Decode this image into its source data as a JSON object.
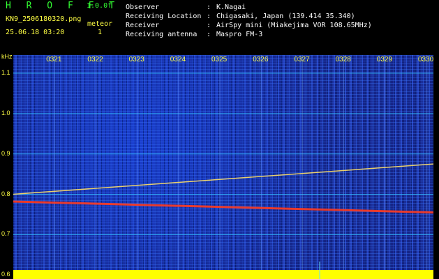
{
  "header": {
    "app_title": "H R O F F T",
    "version": "1.0.0f",
    "filename": "KN9_2506180320.png",
    "timestamp": "25.06.18 03:20",
    "meteor_label": "meteor",
    "meteor_count": "1",
    "info": [
      {
        "key": "Observer",
        "sep": ":",
        "value": "K.Nagai"
      },
      {
        "key": "Receiving Location",
        "sep": ":",
        "value": "Chigasaki, Japan (139.414 35.340)"
      },
      {
        "key": "Receiver",
        "sep": ":",
        "value": "AirSpy mini (Miakejima VOR 108.65MHz)"
      },
      {
        "key": "Receiving antenna",
        "sep": ":",
        "value": "Maspro FM-3"
      }
    ]
  },
  "colors": {
    "label": "#ffff44",
    "title": "#33ff33",
    "grid": "#33c8ff",
    "trace_lower": "#ff3b1f",
    "trace_upper": "#ffe066",
    "baseline": "#ffff00"
  },
  "chart_data": {
    "type": "heatmap",
    "ylabel": "kHz",
    "yticks": [
      "1.1",
      "1.0",
      "0.9",
      "0.8",
      "0.7",
      "0.6"
    ],
    "xticks": [
      "0321",
      "0322",
      "0323",
      "0324",
      "0325",
      "0326",
      "0327",
      "0328",
      "0329",
      "0330"
    ],
    "traces": [
      {
        "x": [
          "0320",
          "0330"
        ],
        "y": [
          0.8,
          0.875
        ]
      },
      {
        "x": [
          "0320",
          "0330"
        ],
        "y": [
          0.782,
          0.755
        ]
      }
    ],
    "ylim": [
      0.59,
      1.145
    ]
  }
}
